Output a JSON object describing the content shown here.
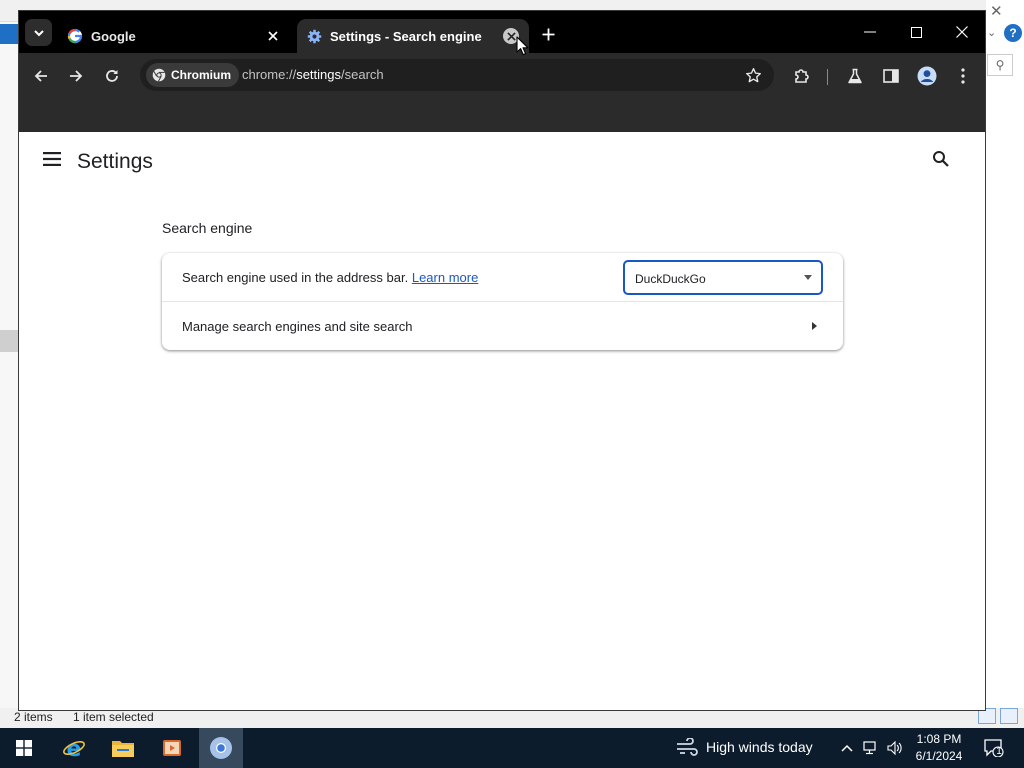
{
  "desktop": {
    "status_items": "2 items",
    "status_selected": "1 item selected"
  },
  "browser": {
    "tabs": [
      {
        "title": "Google",
        "icon": "google-icon",
        "active": false
      },
      {
        "title": "Settings - Search engine",
        "icon": "gear-icon",
        "active": true
      }
    ],
    "omnibox": {
      "chip_label": "Chromium",
      "url_prefix": "chrome://",
      "url_main": "settings",
      "url_suffix": "/search"
    }
  },
  "settings": {
    "page_title": "Settings",
    "section_title": "Search engine",
    "row1_label": "Search engine used in the address bar.",
    "row1_link": "Learn more",
    "search_engine_selected": "DuckDuckGo",
    "row2_label": "Manage search engines and site search"
  },
  "taskbar": {
    "weather_text": "High winds today",
    "clock_time": "1:08 PM",
    "clock_date": "6/1/2024",
    "notification_count": "1"
  },
  "colors": {
    "accent": "#1a57c5",
    "browser_frame": "#000000",
    "toolbar": "#2b2b2b",
    "taskbar": "#0c1c2c"
  }
}
